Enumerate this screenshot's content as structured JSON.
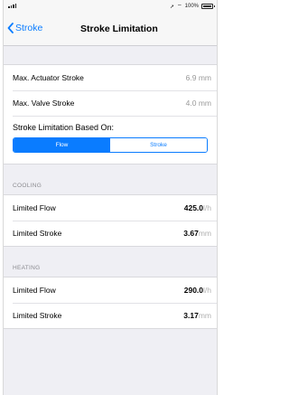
{
  "status": {
    "right_text": "100%"
  },
  "nav": {
    "back_label": "Stroke",
    "title": "Stroke Limitation"
  },
  "info": [
    {
      "label": "Max. Actuator Stroke",
      "value": "6.9 mm"
    },
    {
      "label": "Max. Valve Stroke",
      "value": "4.0 mm"
    }
  ],
  "segment": {
    "label": "Stroke Limitation Based On:",
    "options": [
      "Flow",
      "Stroke"
    ],
    "selected": "Flow"
  },
  "cooling": {
    "header": "COOLING",
    "flow_label": "Limited Flow",
    "flow_value": "425.0",
    "flow_unit": "l/h",
    "stroke_label": "Limited Stroke",
    "stroke_value": "3.67",
    "stroke_unit": "mm"
  },
  "heating": {
    "header": "HEATING",
    "flow_label": "Limited Flow",
    "flow_value": "290.0",
    "flow_unit": "l/h",
    "stroke_label": "Limited Stroke",
    "stroke_value": "3.17",
    "stroke_unit": "mm"
  },
  "colors": {
    "accent": "#0a7cff",
    "background": "#efeff4"
  }
}
